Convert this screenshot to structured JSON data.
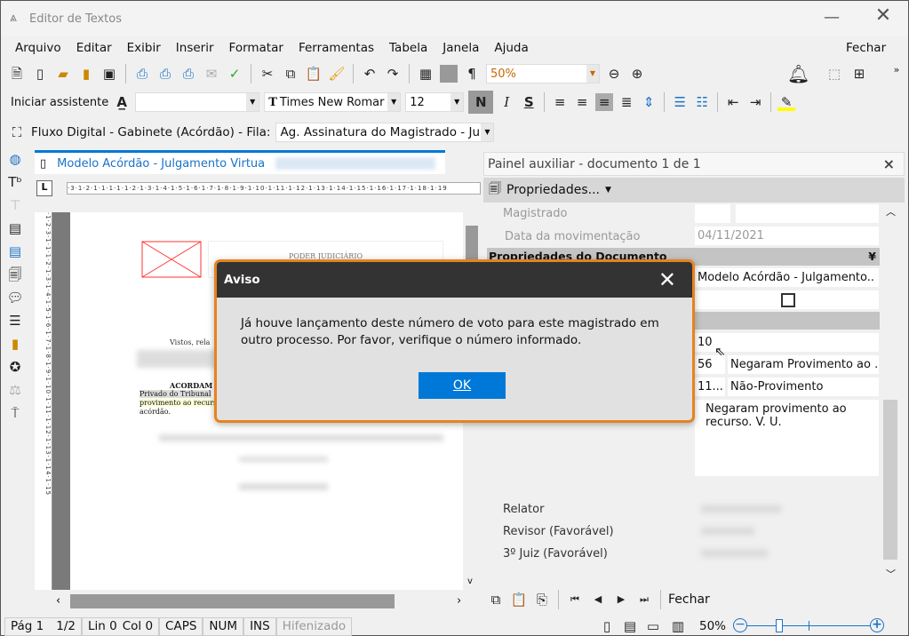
{
  "window": {
    "title": "Editor de Textos"
  },
  "menu": [
    {
      "label": "Arquivo"
    },
    {
      "label": "Editar"
    },
    {
      "label": "Exibir"
    },
    {
      "label": "Inserir"
    },
    {
      "label": "Formatar"
    },
    {
      "label": "Ferramentas"
    },
    {
      "label": "Tabela"
    },
    {
      "label": "Janela"
    },
    {
      "label": "Ajuda"
    }
  ],
  "menu_close": "Fechar",
  "toolbar": {
    "zoom": "50%",
    "assistant": "Iniciar assistente",
    "style": "",
    "font": "Times New Romar",
    "size": "12",
    "bold": "N",
    "italic": "I",
    "strike": "S"
  },
  "flow": {
    "label": "Fluxo Digital - Gabinete (Acórdão) - Fila:",
    "queue": "Ag. Assinatura do Magistrado - Jul"
  },
  "doc": {
    "tab": "Modelo Acórdão - Julgamento Virtua",
    "header": "PODER JUDICIÁRIO",
    "visto": "Vistos, rela",
    "acordam": "ACORDAM",
    "line1": "Privado do Tribunal",
    "line2": "provimento ao recurs",
    "line3": "acórdão."
  },
  "panel": {
    "title": "Painel auxiliar - documento 1 de 1",
    "close": "×",
    "properties": "Propriedades...",
    "magistrado": "Magistrado",
    "data_label": "Data da movimentação",
    "data_value": "04/11/2021",
    "section": "Propriedades do Documento",
    "model": "Modelo Acórdão - Julgamento..",
    "num": "10",
    "code1": "56",
    "desc1": "Negaram Provimento ao ...",
    "code2": "11...",
    "desc2": "Não-Provimento",
    "text": "Negaram provimento ao recurso. V. U.",
    "relator": "Relator",
    "revisor": "Revisor  (Favorável)",
    "juiz3": "3º Juiz  (Favorável)",
    "fechar": "Fechar"
  },
  "status": {
    "page": "Pág 1",
    "pages": "1/2",
    "lin": "Lin 0",
    "col": "Col 0",
    "caps": "CAPS",
    "num": "NUM",
    "ins": "INS",
    "hyph": "Hifenizado",
    "zoom": "50%",
    "zoom_slider_percent": 50
  },
  "dialog": {
    "title": "Aviso",
    "message": "Já houve lançamento deste número de voto para este magistrado em outro processo. Por favor, verifique o número informado.",
    "ok": "OK"
  },
  "colors": {
    "accent": "#0078d7",
    "dialog_border": "#e8821e"
  }
}
